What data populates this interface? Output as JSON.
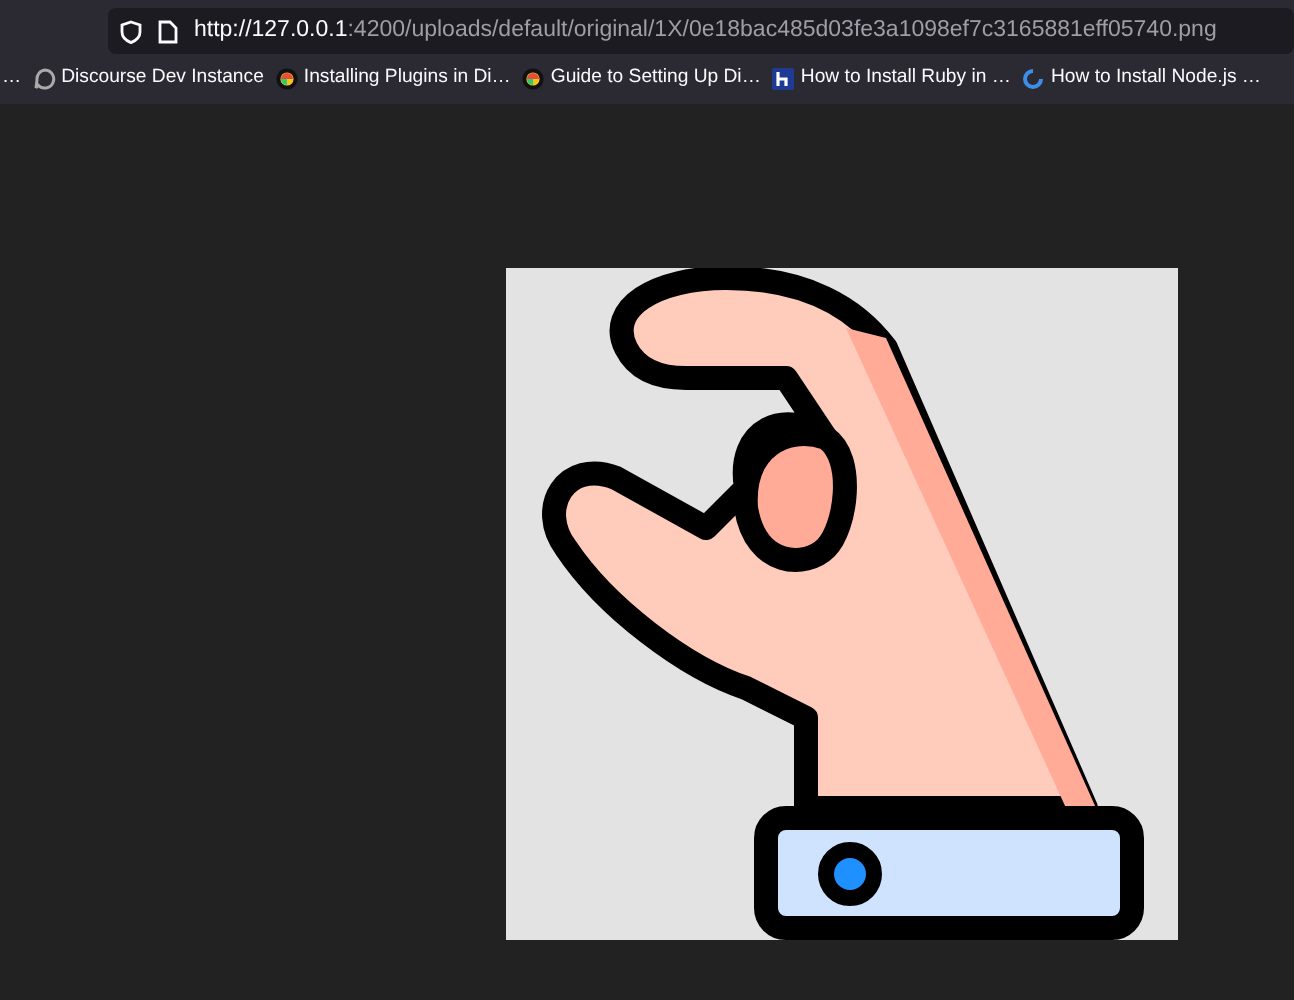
{
  "address_bar": {
    "url_host": "http://127.0.0.1",
    "url_rest": ":4200/uploads/default/original/1X/0e18bac485d03fe3a1098ef7c3165881eff05740.png"
  },
  "bookmarks": [
    {
      "title": "…",
      "kind": "cut"
    },
    {
      "title": "Discourse Dev Instance",
      "kind": "outline"
    },
    {
      "title": "Installing Plugins in Di…",
      "kind": "bubble"
    },
    {
      "title": "Guide to Setting Up Di…",
      "kind": "bubble"
    },
    {
      "title": "How to Install Ruby in …",
      "kind": "letter"
    },
    {
      "title": "How to Install Node.js …",
      "kind": "ring"
    }
  ]
}
